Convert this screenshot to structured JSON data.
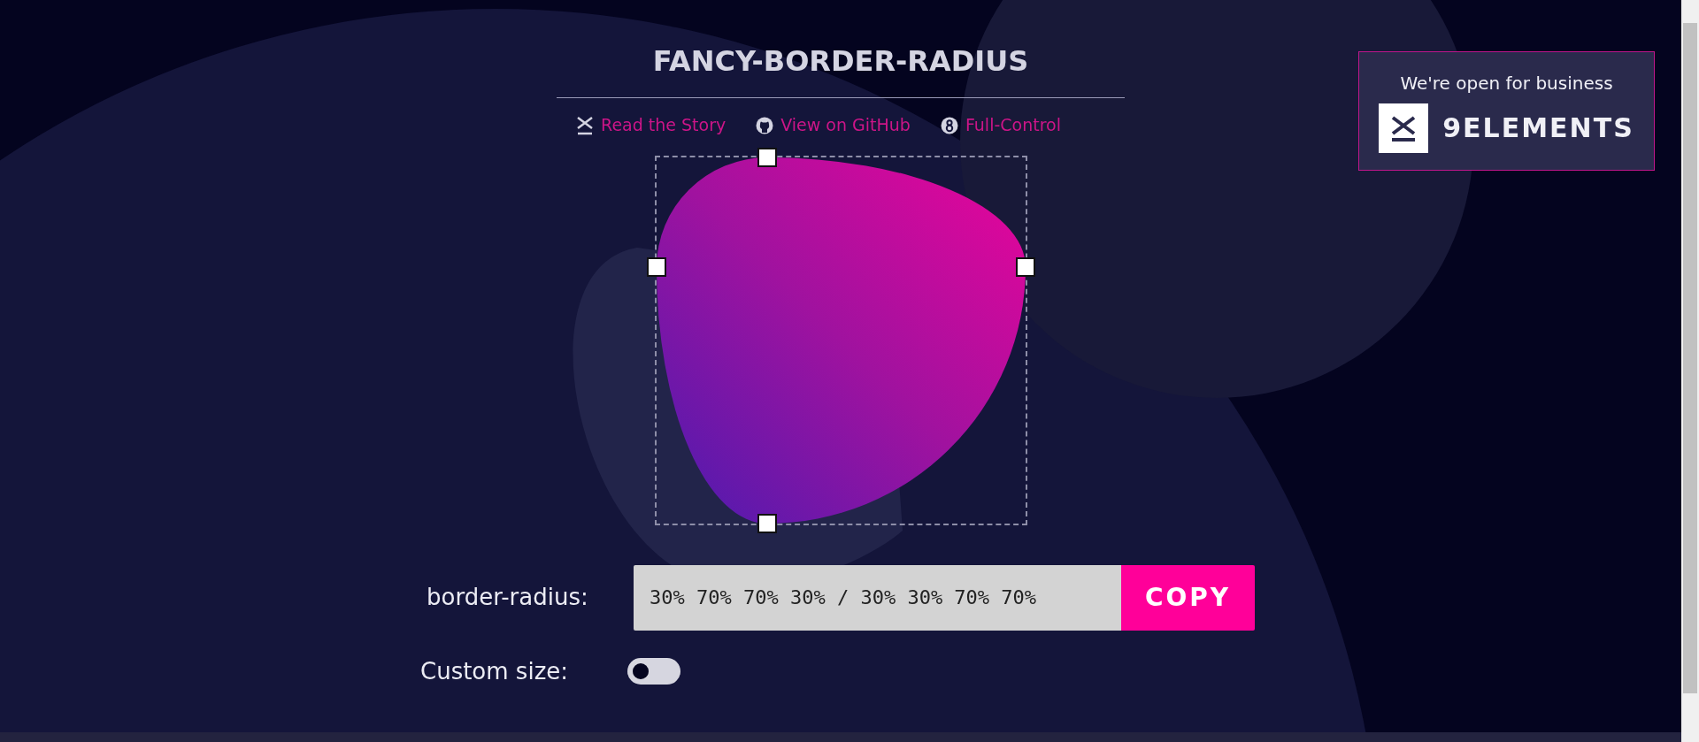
{
  "title": "FANCY-BORDER-RADIUS",
  "links": [
    {
      "label": "Read the Story",
      "kind": "story"
    },
    {
      "label": "View on GitHub",
      "kind": "github"
    },
    {
      "label": "Full-Control",
      "kind": "control"
    }
  ],
  "border_radius": {
    "label": "border-radius:",
    "value": "30% 70% 70% 30% / 30% 30% 70% 70%",
    "button": "COPY"
  },
  "custom_size": {
    "label": "Custom size:",
    "on": false
  },
  "ad": {
    "tagline": "We're open for business",
    "brand": "9ELEMENTS"
  }
}
